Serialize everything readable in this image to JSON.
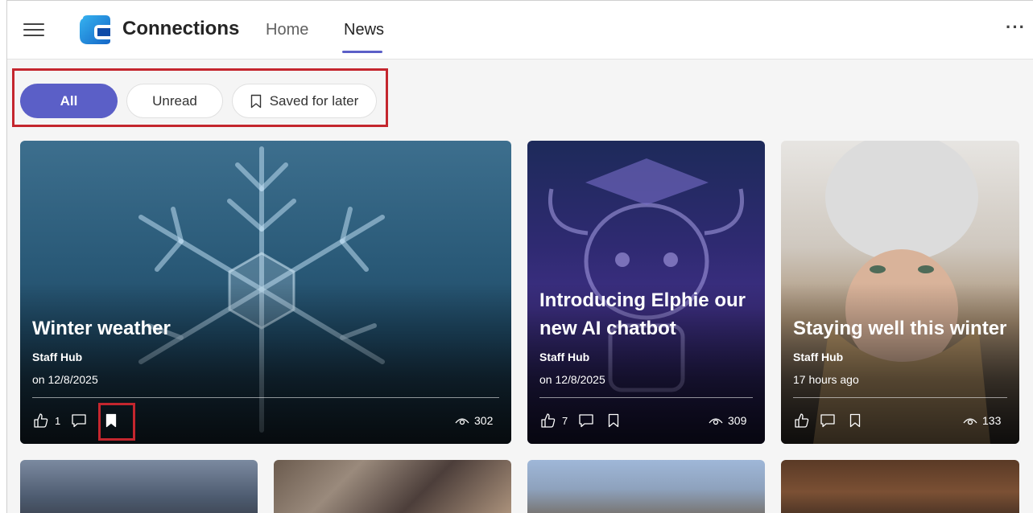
{
  "header": {
    "app_title": "Connections",
    "nav": [
      {
        "label": "Home",
        "selected": false
      },
      {
        "label": "News",
        "selected": true
      }
    ],
    "more_label": "···",
    "icons": {
      "menu": "hamburger-icon",
      "logo": "connections-logo",
      "more": "more-options-icon"
    }
  },
  "filters": [
    {
      "label": "All",
      "selected": true
    },
    {
      "label": "Unread",
      "selected": false
    },
    {
      "label": "Saved for later",
      "selected": false,
      "icon": "bookmark-icon"
    }
  ],
  "cards": [
    {
      "title_lines": [
        "Winter weather"
      ],
      "source": "Staff Hub",
      "date": "on 12/8/2025",
      "likes": "1",
      "comments": "",
      "saved": true,
      "views": "302"
    },
    {
      "title_lines": [
        "Introducing Elphie our",
        "new AI chatbot"
      ],
      "source": "Staff Hub",
      "date": "on 12/8/2025",
      "likes": "7",
      "comments": "",
      "saved": false,
      "views": "309"
    },
    {
      "title_lines": [
        "Staying well this winter"
      ],
      "source": "Staff Hub",
      "date": "17 hours ago",
      "likes": "",
      "comments": "",
      "saved": false,
      "views": "133"
    }
  ],
  "colors": {
    "accent": "#5b5fc7",
    "highlight": "#c4262e"
  }
}
